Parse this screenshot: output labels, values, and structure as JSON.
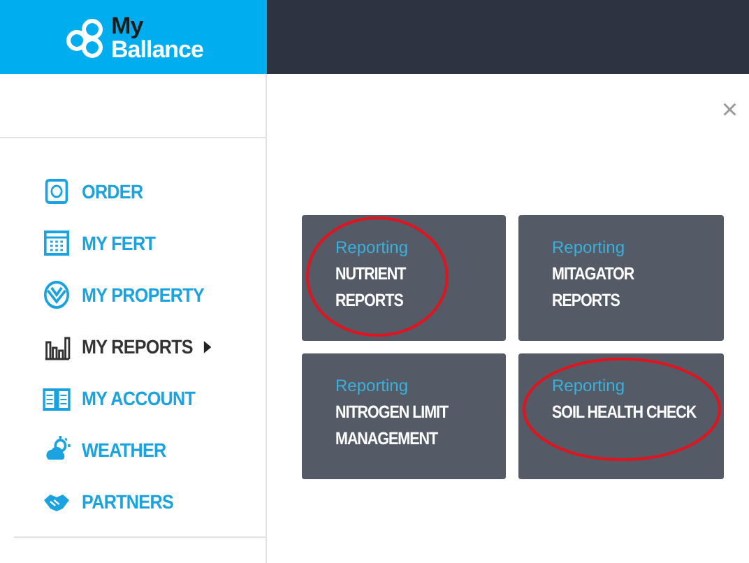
{
  "header": {
    "logo_line_1": "My",
    "logo_line_2": "Ballance"
  },
  "sidebar": {
    "items": [
      {
        "label": "ORDER",
        "kind": "order",
        "selected": false
      },
      {
        "label": "MY FERT",
        "kind": "calendar",
        "selected": false
      },
      {
        "label": "MY PROPERTY",
        "kind": "property",
        "selected": false
      },
      {
        "label": "MY REPORTS",
        "kind": "reports",
        "selected": true
      },
      {
        "label": "MY ACCOUNT",
        "kind": "account",
        "selected": false
      },
      {
        "label": "WEATHER",
        "kind": "weather",
        "selected": false
      },
      {
        "label": "PARTNERS",
        "kind": "partners",
        "selected": false
      }
    ]
  },
  "panel": {
    "close": "×",
    "cards": [
      {
        "category": "Reporting",
        "title": "NUTRIENT\nREPORTS",
        "circled": true
      },
      {
        "category": "Reporting",
        "title": "MITAGATOR\nREPORTS",
        "circled": false
      },
      {
        "category": "Reporting",
        "title": "NITROGEN LIMIT\nMANAGEMENT",
        "circled": false
      },
      {
        "category": "Reporting",
        "title": "SOIL HEALTH CHECK",
        "circled": true
      }
    ]
  }
}
